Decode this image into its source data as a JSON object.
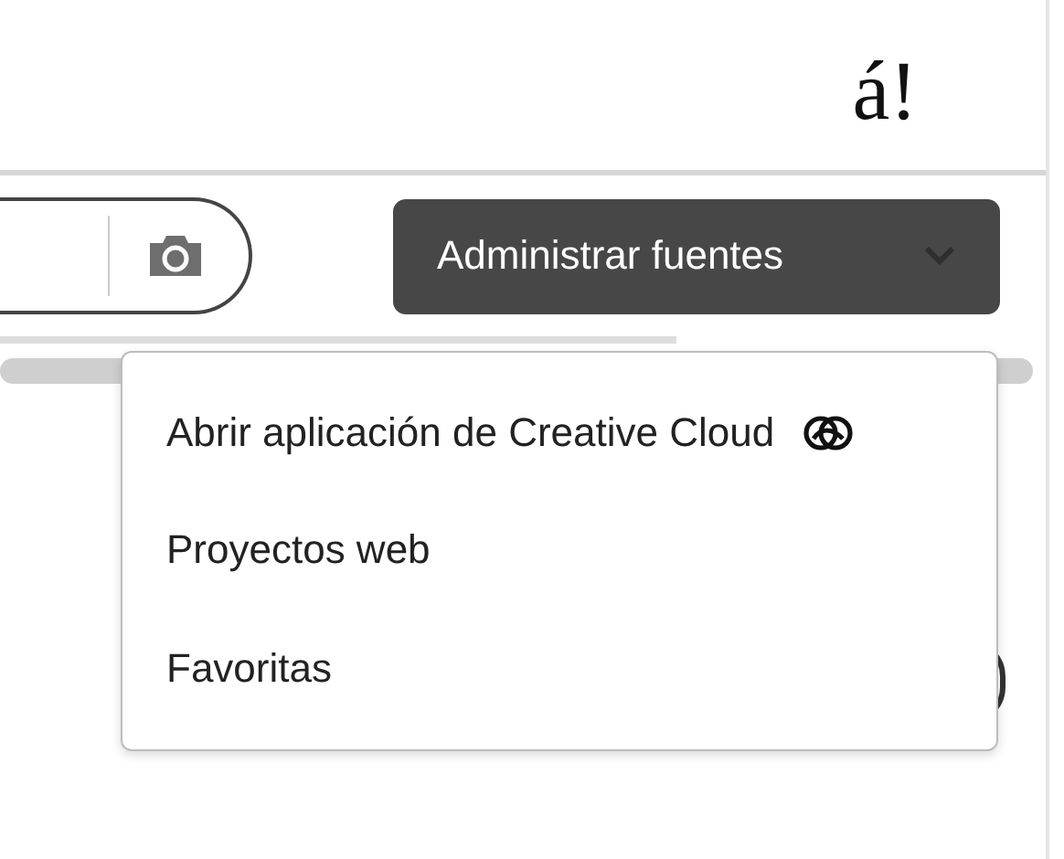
{
  "logo": {
    "text": "á!"
  },
  "search": {
    "kind": "pill"
  },
  "manage_button": {
    "label": "Administrar fuentes",
    "expanded": true
  },
  "menu": {
    "items": [
      {
        "label": "Abrir aplicación de Creative Cloud",
        "kind": "app-link"
      },
      {
        "label": "Proyectos web",
        "kind": "plain"
      },
      {
        "label": "Favoritas",
        "kind": "plain"
      }
    ]
  }
}
